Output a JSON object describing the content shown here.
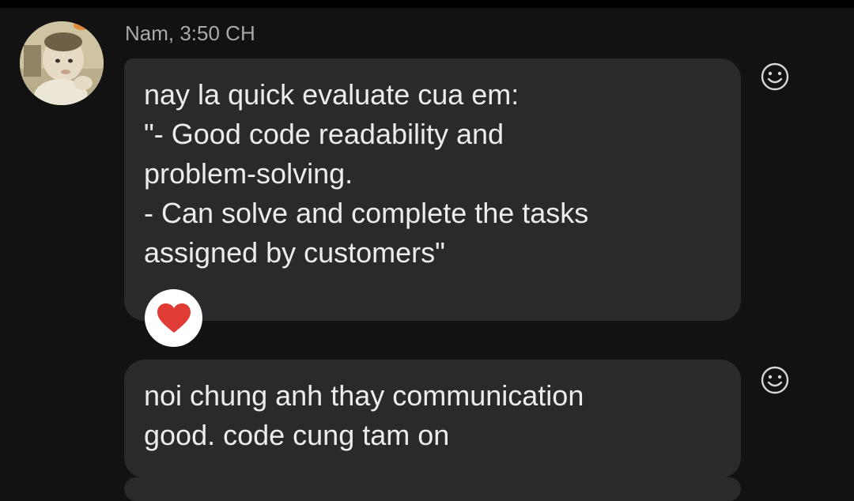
{
  "header": {
    "sender_line": "Nam, 3:50 CH"
  },
  "messages": [
    {
      "text": "nay la quick evaluate cua em:\n\"- Good code readability and\nproblem-solving.\n- Can solve and complete the tasks\nassigned by customers\"",
      "reaction": "heart-icon"
    },
    {
      "text": "noi chung anh thay communication\ngood. code cung tam on"
    }
  ],
  "colors": {
    "background": "#121212",
    "bubble": "#2a2a2c",
    "text": "#ececec",
    "meta_text": "#a9a9a9",
    "heart": "#e03b35",
    "reaction_bg": "#ffffff"
  },
  "icons": {
    "react_button": "smiley-icon",
    "reaction": "heart-icon"
  }
}
